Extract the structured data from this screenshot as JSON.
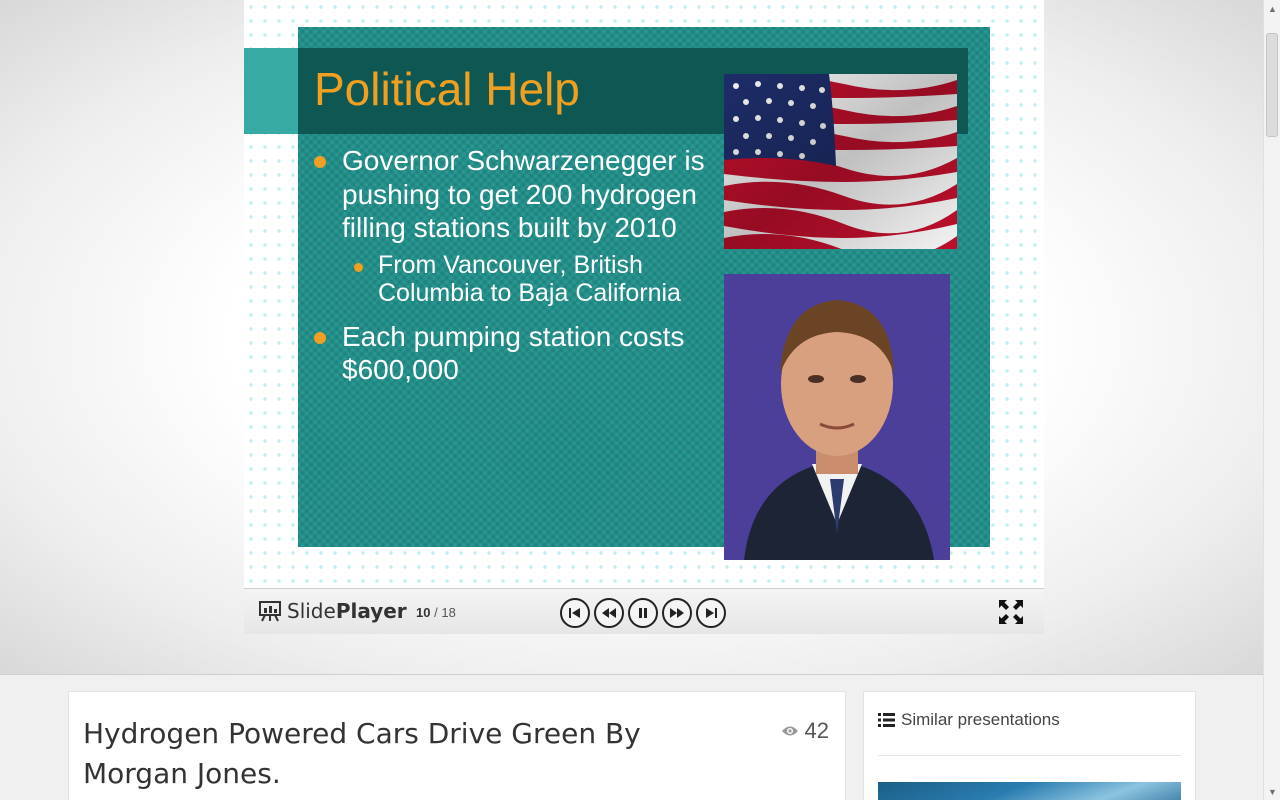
{
  "slide": {
    "title": "Political Help",
    "bullets": [
      {
        "text": "Governor Schwarzenegger is pushing to get 200 hydrogen filling stations built by 2010",
        "sub": [
          "From Vancouver, British Columbia to Baja California"
        ]
      },
      {
        "text": "Each pumping station costs $600,000",
        "sub": []
      }
    ]
  },
  "player": {
    "brand_a": "Slide",
    "brand_b": "Player",
    "current_slide": "10",
    "separator": "/",
    "total_slides": "18"
  },
  "presentation": {
    "title": "Hydrogen Powered Cars Drive Green By Morgan Jones.",
    "views": "42"
  },
  "sidebar": {
    "heading": "Similar presentations"
  },
  "colors": {
    "accent_orange": "#f0a020",
    "teal": "#1f8f8a",
    "title_band": "#0f5753"
  }
}
